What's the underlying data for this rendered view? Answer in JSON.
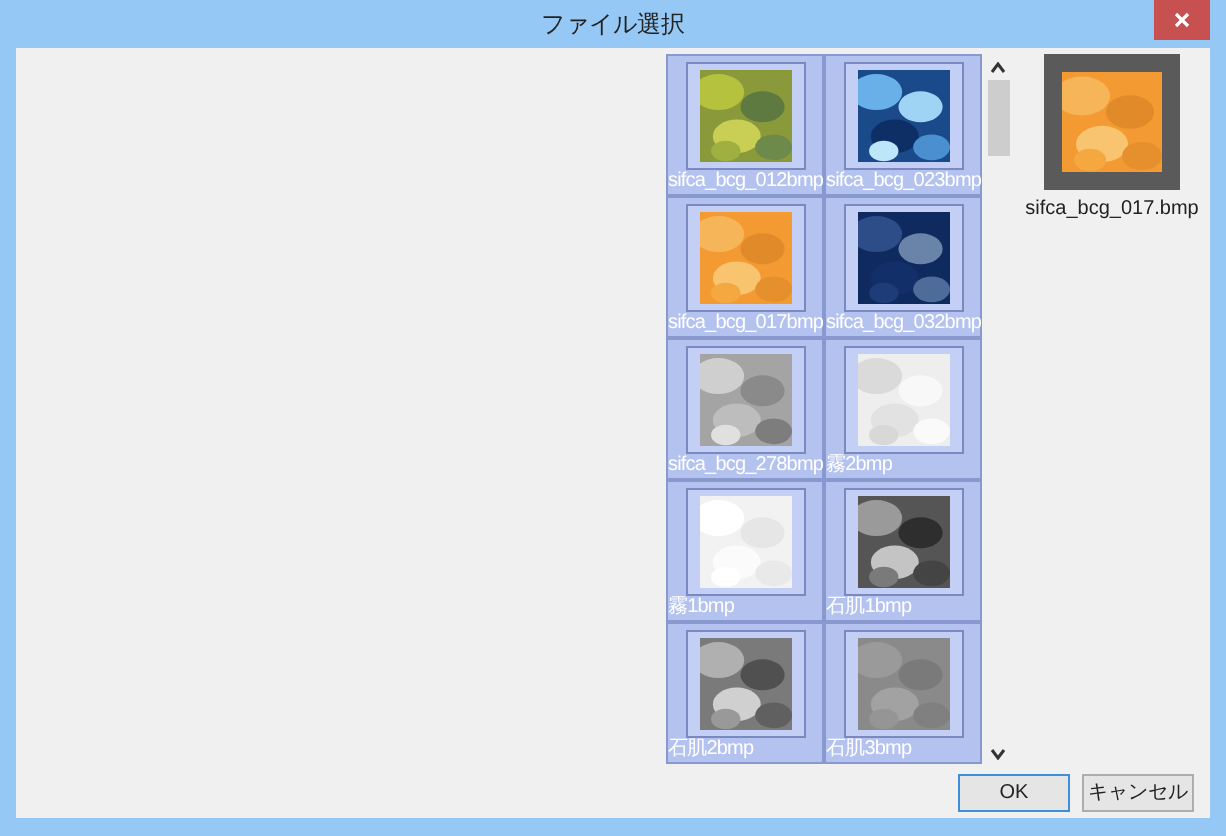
{
  "window": {
    "title": "ファイル選択"
  },
  "files": [
    {
      "name": "sifca_bcg_012bmp"
    },
    {
      "name": "sifca_bcg_023bmp"
    },
    {
      "name": "sifca_bcg_017bmp"
    },
    {
      "name": "sifca_bcg_032bmp"
    },
    {
      "name": "sifca_bcg_278bmp"
    },
    {
      "name": "霧2bmp"
    },
    {
      "name": "霧1bmp"
    },
    {
      "name": "石肌1bmp"
    },
    {
      "name": "石肌2bmp"
    },
    {
      "name": "石肌3bmp"
    }
  ],
  "preview": {
    "name": "sifca_bcg_017.bmp"
  },
  "buttons": [
    "OK",
    "キャンセル"
  ]
}
